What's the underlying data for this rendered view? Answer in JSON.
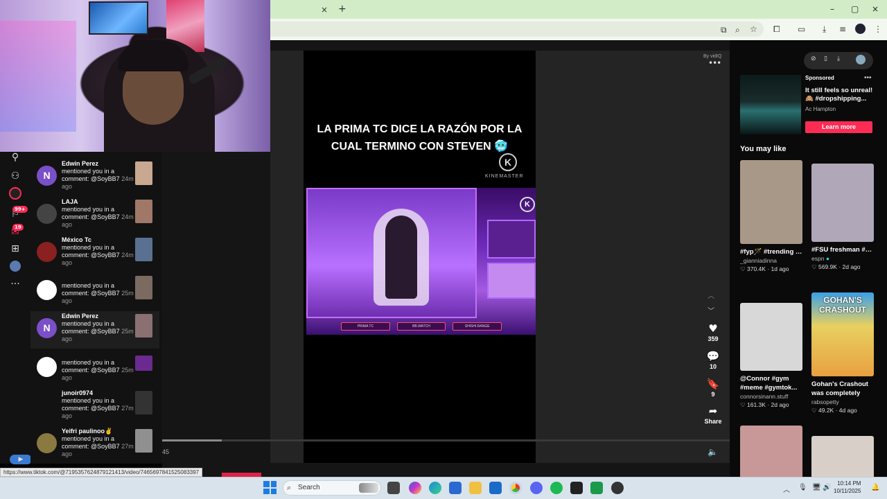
{
  "browser": {
    "tab_close": "×",
    "tab_new": "+",
    "window_min": "–",
    "window_restore": "▢",
    "window_close": "×"
  },
  "rail": {
    "badges": [
      "99+",
      "19"
    ]
  },
  "notifications": [
    {
      "name": "Edwin Perez",
      "avatar_letter": "N",
      "avatar_color": "#7a4fc8",
      "text": "mentioned you in a comment: @SoyBB7",
      "time": "24m ago",
      "thumb_color": "#c8a890"
    },
    {
      "name": "LAJA",
      "avatar_letter": "",
      "avatar_color": "#444444",
      "text": "mentioned you in a comment: @SoyBB7",
      "time": "24m ago",
      "thumb_color": "#a07868"
    },
    {
      "name": "México Tc",
      "avatar_letter": "",
      "avatar_color": "#8a2020",
      "text": "mentioned you in a comment: @SoyBB7",
      "time": "24m ago",
      "thumb_color": "#5a7090"
    },
    {
      "name": "",
      "avatar_letter": "",
      "avatar_color": "#ffffff",
      "text": "mentioned you in a comment: @SoyBB7",
      "time": "25m ago",
      "thumb_color": "#7a6a60"
    },
    {
      "name": "Edwin Perez",
      "avatar_letter": "N",
      "avatar_color": "#7a4fc8",
      "text": "mentioned you in a comment: @SoyBB7",
      "time": "25m ago",
      "thumb_color": "#8a7070"
    },
    {
      "name": "",
      "avatar_letter": "",
      "avatar_color": "#ffffff",
      "text": "mentioned you in a comment: @SoyBB7",
      "time": "25m ago",
      "thumb_color": "#6a2a90"
    },
    {
      "name": "junoir0974",
      "avatar_letter": "",
      "avatar_color": "#121212",
      "text": "mentioned you in a comment: @SoyBB7",
      "time": "27m ago",
      "thumb_color": "#333333"
    },
    {
      "name": "Yeifri paulinoo✌",
      "avatar_letter": "",
      "avatar_color": "#8a7a40",
      "text": "mentioned you in a comment: @SoyBB7",
      "time": "27m ago",
      "thumb_color": "#909090"
    }
  ],
  "video": {
    "title": "LA PRIMA TC DICE LA RAZÓN POR LA CUAL TERMINO CON STEVEN 🥶",
    "watermark": "KINEMASTER",
    "watermark_letter": "K",
    "overlay_tabs": [
      "PRIMA TC",
      "BB.WATCH",
      "SHISHI.RANGE"
    ],
    "timecode": "45",
    "progress": 0.105,
    "by_label": "By vidIQ"
  },
  "actions": {
    "likes": "359",
    "comments": "10",
    "saves": "9",
    "share_label": "Share"
  },
  "sidebar_right": {
    "sponsored_label": "Sponsored",
    "ad_text": "It still feels so unreal! 🙈 #dropshipping...",
    "ad_author": "Ac Hampton",
    "learn_more": "Learn more",
    "section_title": "You may like",
    "recommendations": [
      {
        "caption": "#fyp🪄 #trending #gianniadinna",
        "author": "_gianniadinna",
        "likes": "370.4K",
        "age": "1d ago",
        "color": "#a89888",
        "verified": false
      },
      {
        "caption": "#FSU freshman #EthanPritchard w...",
        "author": "espn",
        "likes": "569.9K",
        "age": "2d ago",
        "color": "#b0a8b8",
        "verified": true
      },
      {
        "caption": "@Connor #gym #meme #gymtok...",
        "author": "connorsinann.stuff",
        "likes": "161.3K",
        "age": "2d ago",
        "color": "#d8d8d8",
        "verified": false
      },
      {
        "caption": "Gohan's Crashout was completely vall...",
        "author": "rabsopetty",
        "likes": "49.2K",
        "age": "4d ago",
        "color": "#e8c860",
        "verified": false
      },
      {
        "caption": "",
        "author": "",
        "likes": "",
        "age": "",
        "color": "#c89898",
        "verified": false
      },
      {
        "caption": "",
        "author": "",
        "likes": "",
        "age": "",
        "color": "#d8d0c8",
        "verified": false
      }
    ],
    "rec_overlay_texts": [
      "GOHAN'S CRASHOUT"
    ]
  },
  "status_url": "https://www.tiktok.com/@7195357624879121413/video/7465697841525083397",
  "taskbar": {
    "search_label": "Search",
    "time": "10:14 PM",
    "date": "10/11/2025"
  }
}
